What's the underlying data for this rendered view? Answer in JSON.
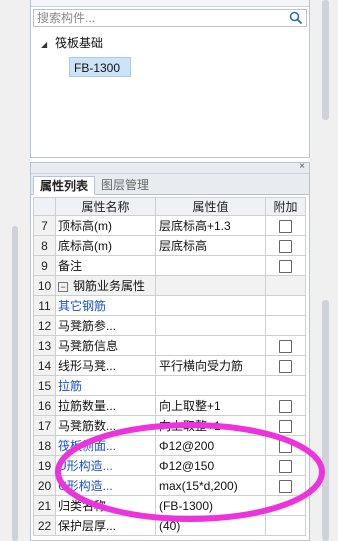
{
  "search": {
    "placeholder": "搜索构件..."
  },
  "tree": {
    "root_label": "筏板基础",
    "child_label": "FB-1300"
  },
  "props_panel": {
    "close_glyph": "×",
    "tabs": [
      {
        "label": "属性列表"
      },
      {
        "label": "图层管理"
      }
    ],
    "columns": {
      "name": "属性名称",
      "value": "属性值",
      "add": "附加"
    },
    "rows": [
      {
        "num": "7",
        "name": "顶标高(m)",
        "value": "层底标高+1.3"
      },
      {
        "num": "8",
        "name": "底标高(m)",
        "value": "层底标高"
      },
      {
        "num": "9",
        "name": "备注",
        "value": ""
      },
      {
        "num": "10",
        "toggle": "−",
        "name": "钢筋业务属性",
        "value": ""
      },
      {
        "num": "11",
        "name": "其它钢筋",
        "value": ""
      },
      {
        "num": "12",
        "name": "马凳筋参...",
        "value": ""
      },
      {
        "num": "13",
        "name": "马凳筋信息",
        "value": ""
      },
      {
        "num": "14",
        "name": "线形马凳...",
        "value": "平行横向受力筋"
      },
      {
        "num": "15",
        "name": "拉筋",
        "value": ""
      },
      {
        "num": "16",
        "name": "拉筋数量...",
        "value": "向上取整+1"
      },
      {
        "num": "17",
        "name": "马凳筋数...",
        "value": "向上取整+1"
      },
      {
        "num": "18",
        "name": "筏板侧面...",
        "value": "Φ12@200"
      },
      {
        "num": "19",
        "name": "U形构造...",
        "value": "Φ12@150"
      },
      {
        "num": "20",
        "name": "U形构造...",
        "value": "max(15*d,200)"
      },
      {
        "num": "21",
        "name": "归类名称",
        "value": "(FB-1300)"
      },
      {
        "num": "22",
        "name": "保护层厚...",
        "value": "(40)"
      }
    ]
  },
  "colors": {
    "link": "#1a4fd8",
    "annotation": "#ee33dd",
    "selection": "#cde3f7"
  }
}
